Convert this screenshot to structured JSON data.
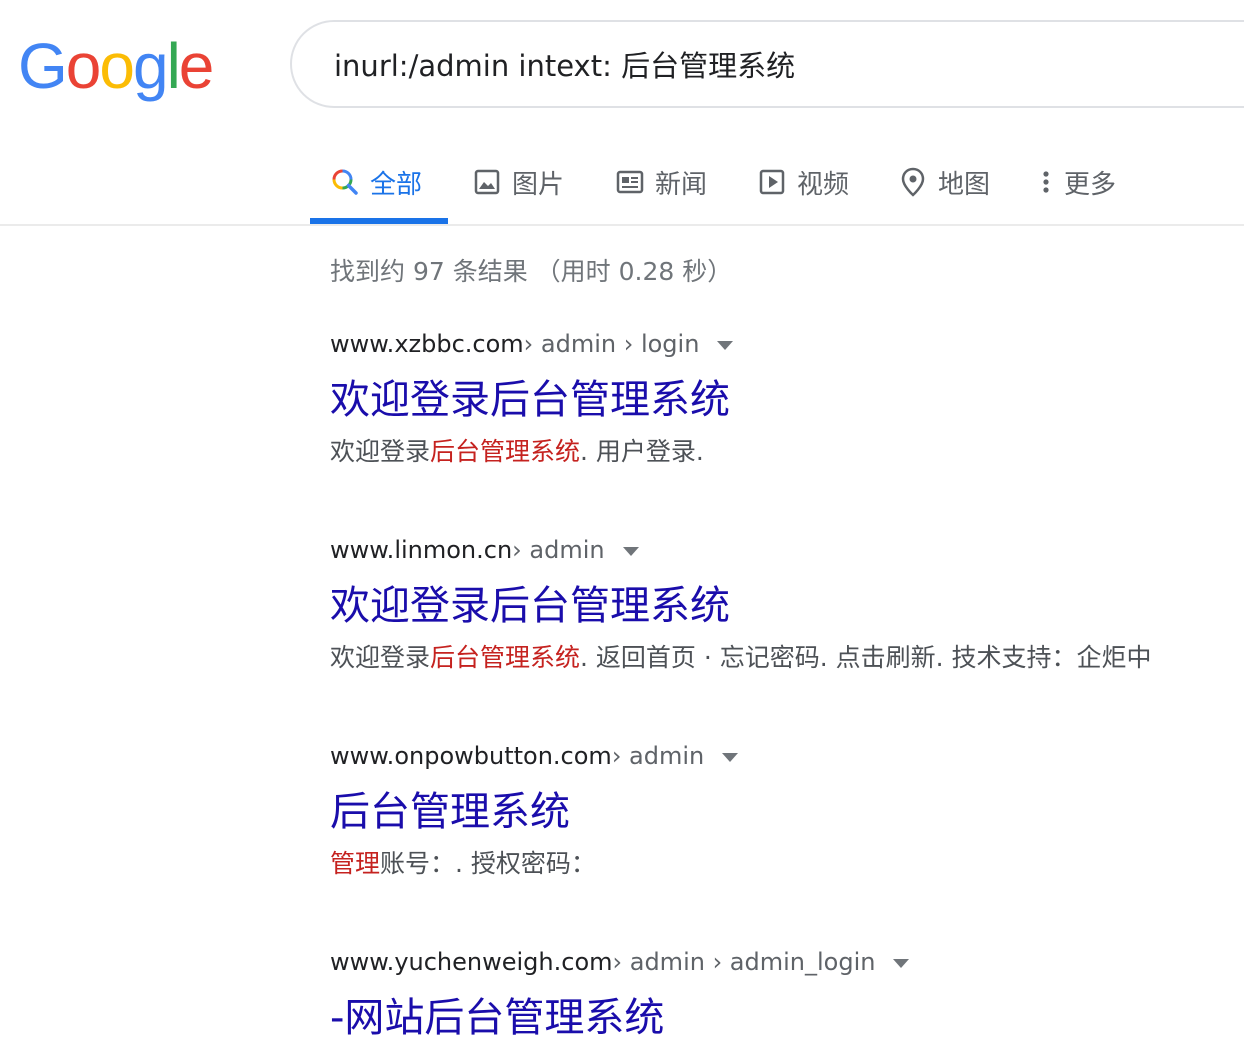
{
  "logo": {
    "letters": [
      "G",
      "o",
      "o",
      "g",
      "l",
      "e"
    ],
    "colors": [
      "#4285F4",
      "#EA4335",
      "#FBBC05",
      "#4285F4",
      "#34A853",
      "#EA4335"
    ]
  },
  "search": {
    "query": "inurl:/admin intext: 后台管理系统"
  },
  "tabs": [
    {
      "label": "全部",
      "icon": "search-icon",
      "active": true
    },
    {
      "label": "图片",
      "icon": "image-icon"
    },
    {
      "label": "新闻",
      "icon": "news-icon"
    },
    {
      "label": "视频",
      "icon": "video-icon"
    },
    {
      "label": "地图",
      "icon": "map-pin-icon"
    },
    {
      "label": "更多",
      "icon": "more-vert-icon"
    }
  ],
  "stats": "找到约 97 条结果 （用时 0.28 秒）",
  "results": [
    {
      "domain": "www.xzbbc.com",
      "path": " › admin › login",
      "title": "欢迎登录后台管理系统",
      "snippet_pre": "欢迎登录",
      "snippet_hl": "后台管理系统",
      "snippet_post": ". 用户登录."
    },
    {
      "domain": "www.linmon.cn",
      "path": " › admin",
      "title": "欢迎登录后台管理系统",
      "snippet_pre": "欢迎登录",
      "snippet_hl": "后台管理系统",
      "snippet_post": ". 返回首页 · 忘记密码. 点击刷新. 技术支持：企炬中"
    },
    {
      "domain": "www.onpowbutton.com",
      "path": " › admin",
      "title": "后台管理系统",
      "snippet_pre": "",
      "snippet_hl": "管理",
      "snippet_post": "账号：. 授权密码："
    },
    {
      "domain": "www.yuchenweigh.com",
      "path": " › admin › admin_login",
      "title": "-网站后台管理系统"
    }
  ],
  "colors": {
    "link": "#1a0dab",
    "highlight": "#c5221f",
    "accent": "#1a73e8"
  }
}
